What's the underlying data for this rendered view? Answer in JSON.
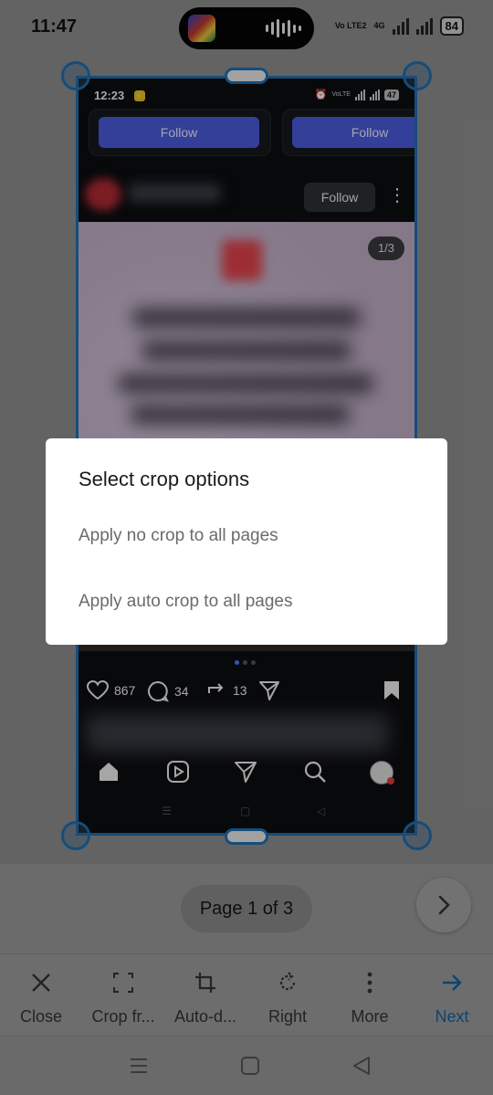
{
  "status_bar": {
    "time": "11:47",
    "network_label": "Vo LTE2",
    "network_type": "4G",
    "battery": "84"
  },
  "preview": {
    "time": "12:23",
    "network_label": "VoLTE",
    "battery": "47",
    "follow_primary_label": "Follow",
    "follow_secondary_label": "Follow",
    "post_follow_label": "Follow",
    "image_counter": "1/3",
    "likes": "867",
    "comments": "34",
    "shares": "13"
  },
  "dialog": {
    "title": "Select crop options",
    "options": [
      "Apply no crop to all pages",
      "Apply auto crop to all pages"
    ]
  },
  "page_indicator": "Page 1 of 3",
  "toolbar": {
    "items": [
      {
        "label": "Close",
        "icon": "close-icon"
      },
      {
        "label": "Crop fr...",
        "icon": "crop-frame-icon"
      },
      {
        "label": "Auto-d...",
        "icon": "crop-icon"
      },
      {
        "label": "Right",
        "icon": "rotate-right-icon"
      },
      {
        "label": "More",
        "icon": "more-vertical-icon"
      },
      {
        "label": "Next",
        "icon": "arrow-right-icon"
      }
    ]
  },
  "colors": {
    "accent": "#1264a3",
    "crop_frame": "#1f6fb0",
    "follow_button": "#4a5bdc"
  }
}
